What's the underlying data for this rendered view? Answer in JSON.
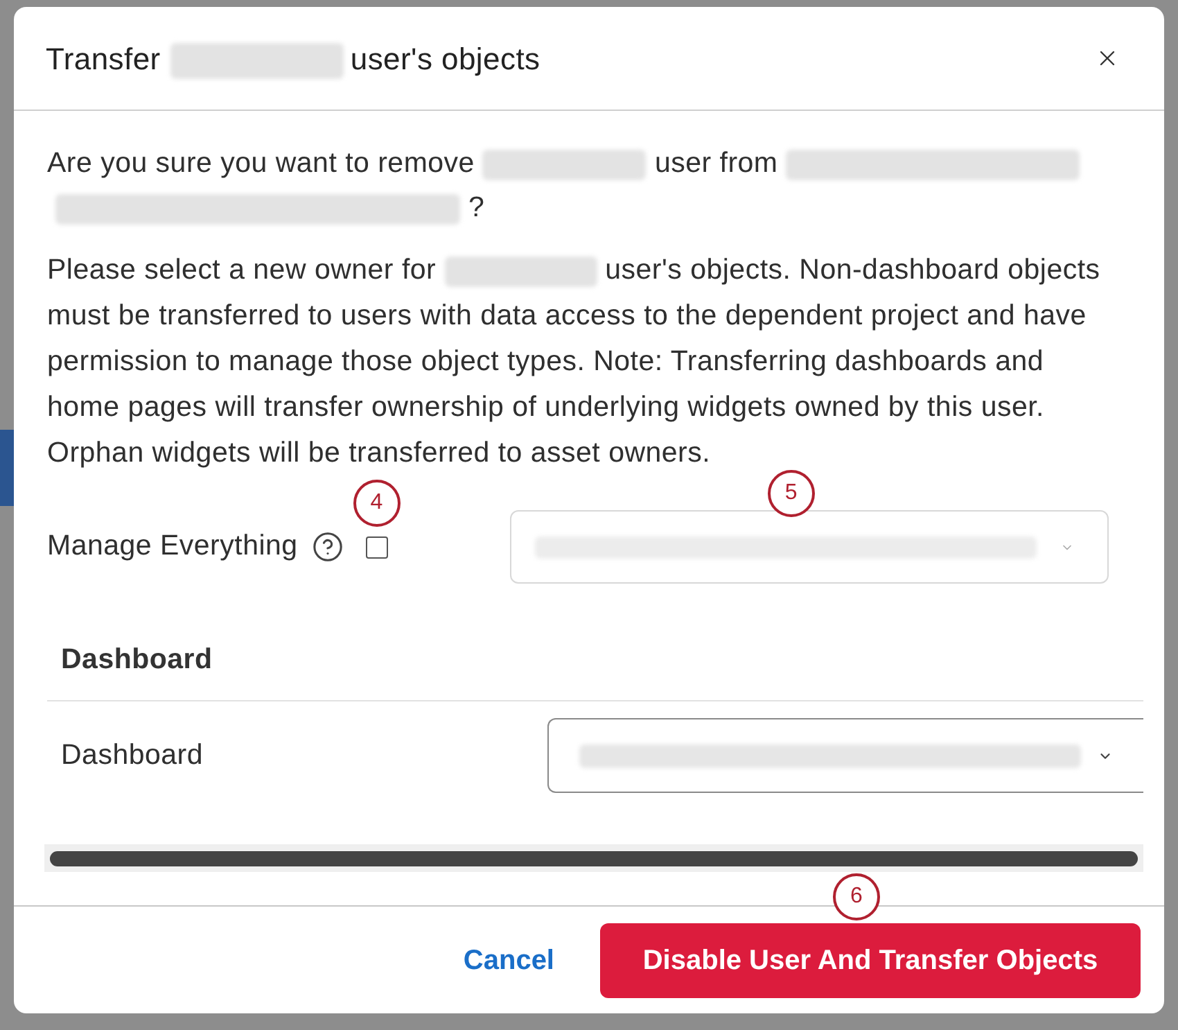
{
  "dialog": {
    "title": [
      {
        "kind": "text",
        "text": "Transfer"
      },
      {
        "kind": "redacted"
      },
      {
        "kind": "text",
        "text": "user's objects"
      }
    ]
  },
  "intro": {
    "lines": [
      [
        {
          "kind": "text",
          "text": "Are you sure you want to remove"
        },
        {
          "kind": "redacted"
        },
        {
          "kind": "text",
          "text": "user from"
        },
        {
          "kind": "redacted"
        }
      ],
      [
        {
          "kind": "redacted"
        },
        {
          "kind": "text",
          "text": "?"
        }
      ]
    ]
  },
  "description": {
    "lines": [
      [
        {
          "kind": "text",
          "text": "Please select a new owner for"
        },
        {
          "kind": "redacted"
        },
        {
          "kind": "text",
          "text": "user's objects. Non-dashboard objects"
        }
      ],
      [
        {
          "kind": "text",
          "text": "must be transferred to users with data access to the dependent project and have"
        }
      ],
      [
        {
          "kind": "text",
          "text": "permission to manage those object types. Note: Transferring dashboards and"
        }
      ],
      [
        {
          "kind": "text",
          "text": "home pages will transfer ownership of underlying widgets owned by this user."
        }
      ],
      [
        {
          "kind": "text",
          "text": "Orphan widgets will be transferred to asset owners."
        }
      ]
    ]
  },
  "manage_everything": {
    "label": "Manage Everything",
    "checked": false,
    "callout": "4",
    "select_callout": "5"
  },
  "sections": [
    {
      "title": "Dashboard",
      "rows": [
        {
          "label": "Dashboard"
        }
      ]
    }
  ],
  "footer": {
    "cancel": "Cancel",
    "confirm": "Disable User And Transfer Objects",
    "callout": "6"
  }
}
